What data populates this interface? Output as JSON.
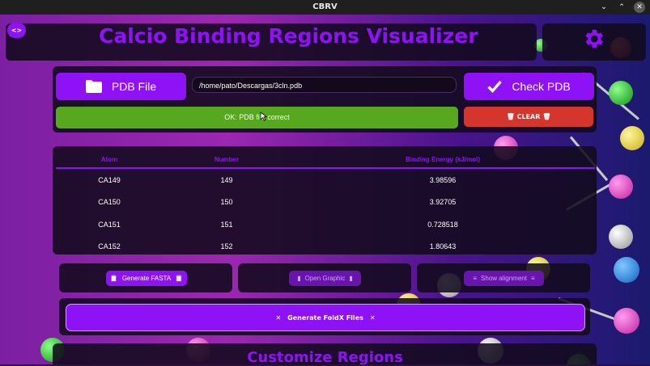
{
  "window": {
    "title": "CBRV",
    "controls": [
      "⌄",
      "⌃",
      "✕"
    ]
  },
  "header": {
    "title": "Calcio Binding Regions Visualizer",
    "toggle_icon": "<>"
  },
  "pdb": {
    "file_button": "PDB File",
    "path_value": "/home/pato/Descargas/3cln.pdb",
    "check_button": "Check PDB",
    "status": "OK: PDB file  correct",
    "clear_button": "CLEAR"
  },
  "table": {
    "headers": [
      "Atom",
      "Number",
      "Binding Energy (kJ/mol)"
    ],
    "rows": [
      [
        "CA149",
        "149",
        "3.98596"
      ],
      [
        "CA150",
        "150",
        "3.92705"
      ],
      [
        "CA151",
        "151",
        "0.728518"
      ],
      [
        "CA152",
        "152",
        "1.80643"
      ]
    ]
  },
  "actions": {
    "generate_fasta": "Generate FASTA",
    "open_graphic": "Open Graphic",
    "show_alignment": "Show alignment",
    "generate_foldx": "Generate FoldX Files"
  },
  "section": {
    "customize": "Customize Regions"
  },
  "colors": {
    "accent": "#8e12f5",
    "ok": "#57a81e",
    "danger": "#d4352c"
  },
  "icons": [
    "folder-icon",
    "check-icon",
    "gear-icon",
    "trash-icon",
    "clipboard-icon",
    "chart-icon",
    "list-icon",
    "tools-icon",
    "cursor-icon"
  ]
}
